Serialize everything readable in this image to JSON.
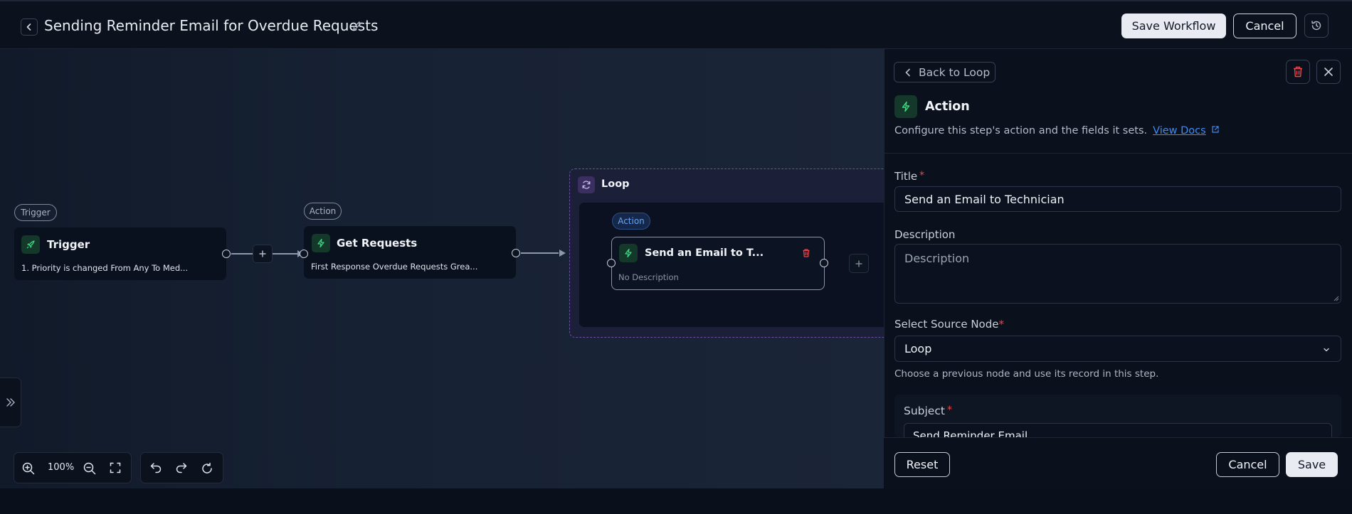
{
  "header": {
    "title": "Sending Reminder Email for Overdue Requests",
    "save_workflow": "Save Workflow",
    "cancel": "Cancel"
  },
  "canvas": {
    "trigger_tag": "Trigger",
    "trigger_node": {
      "title": "Trigger",
      "subtitle": "1. Priority is changed From Any To Med..."
    },
    "get_tag": "Action",
    "get_node": {
      "title": "Get Requests",
      "subtitle": "First Response Overdue Requests Grea..."
    },
    "loop": {
      "title": "Loop",
      "action_pill": "Action",
      "email_node": {
        "title": "Send an Email to T...",
        "subtitle": "No Description"
      }
    },
    "zoom_level": "100%"
  },
  "panel": {
    "back_label": "Back to Loop",
    "heading": "Action",
    "description": "Configure this step's action and the fields it sets.",
    "view_docs": "View Docs",
    "title_label": "Title",
    "title_value": "Send an Email to Technician",
    "desc_label": "Description",
    "desc_placeholder": "Description",
    "source_label": "Select Source Node",
    "source_value": "Loop",
    "source_helper": "Choose a previous node and use its record in this step.",
    "subject_label": "Subject",
    "subject_value": "Send Reminder Email",
    "reset": "Reset",
    "cancel": "Cancel",
    "save": "Save"
  },
  "colors": {
    "accent_green": "#22c55e",
    "link_blue": "#3f8bf5",
    "danger_red": "#e5484d",
    "loop_purple": "#6a4fa5"
  }
}
